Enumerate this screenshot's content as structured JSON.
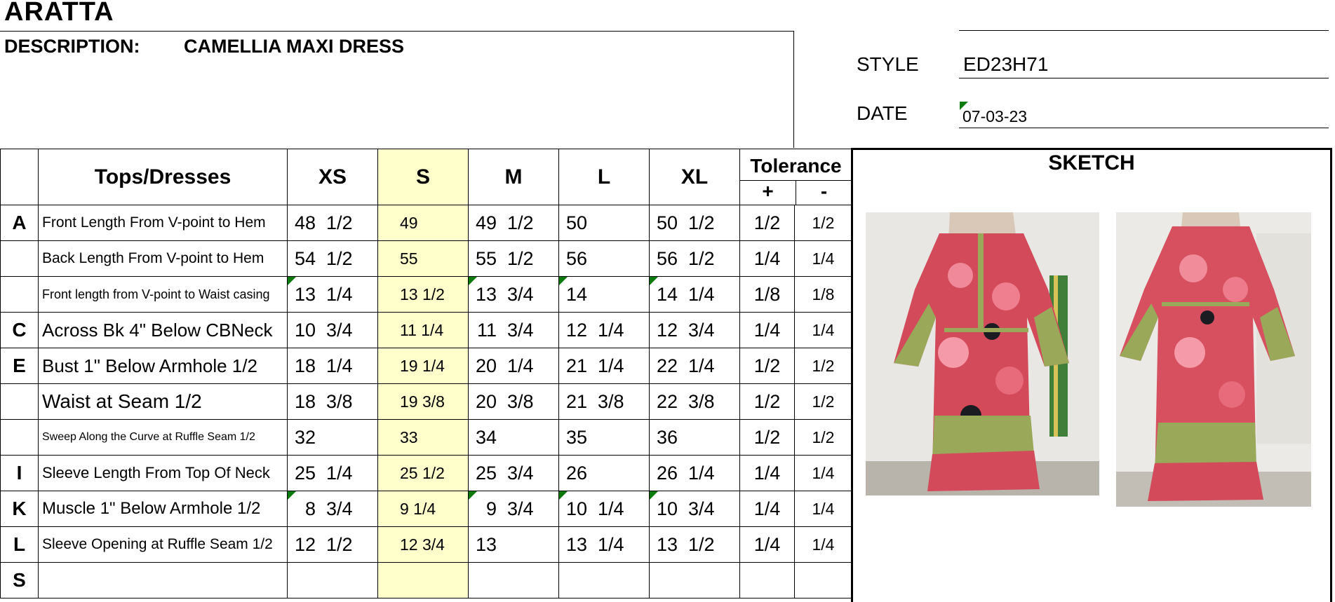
{
  "brand": "ARATTA",
  "description": {
    "label": "DESCRIPTION:",
    "value": "CAMELLIA MAXI DRESS"
  },
  "style": {
    "label": "STYLE",
    "value": "ED23H71"
  },
  "date": {
    "label": "DATE",
    "value": "07-03-23"
  },
  "sketch": {
    "title": "SKETCH",
    "photo_front": "dress-front-photo",
    "photo_back": "dress-back-photo"
  },
  "colors": {
    "s_column": "#ffffcc",
    "marker": "#0a7a0a"
  },
  "table": {
    "header": {
      "category": "Tops/Dresses",
      "sizes": [
        "XS",
        "S",
        "M",
        "L",
        "XL"
      ],
      "tolerance": "Tolerance",
      "plus": "+",
      "minus": "-"
    },
    "rows": [
      {
        "letter": "A",
        "label": "Front Length From V-point to Hem",
        "xs": [
          "48",
          "1/2"
        ],
        "s": "49",
        "m": [
          "49",
          "1/2"
        ],
        "l": [
          "50",
          ""
        ],
        "xl": [
          "50",
          "1/2"
        ],
        "tol_plus": "1/2",
        "tol_minus": "1/2"
      },
      {
        "letter": "",
        "label": "Back Length From V-point to Hem",
        "xs": [
          "54",
          "1/2"
        ],
        "s": "55",
        "m": [
          "55",
          "1/2"
        ],
        "l": [
          "56",
          ""
        ],
        "xl": [
          "56",
          "1/2"
        ],
        "tol_plus": "1/4",
        "tol_minus": "1/4"
      },
      {
        "letter": "",
        "label": "Front length from V-point to Waist casing",
        "xs": [
          "13",
          "1/4"
        ],
        "s": "13 1/2",
        "m": [
          "13",
          "3/4"
        ],
        "l": [
          "14",
          ""
        ],
        "xl": [
          "14",
          "1/4"
        ],
        "tol_plus": "1/8",
        "tol_minus": "1/8"
      },
      {
        "letter": "C",
        "label": "Across Bk 4\" Below CBNeck",
        "xs": [
          "10",
          "3/4"
        ],
        "s": "11 1/4",
        "m": [
          "11",
          "3/4"
        ],
        "l": [
          "12",
          "1/4"
        ],
        "xl": [
          "12",
          "3/4"
        ],
        "tol_plus": "1/4",
        "tol_minus": "1/4"
      },
      {
        "letter": "E",
        "label": " Bust 1\" Below Armhole 1/2",
        "xs": [
          "18",
          "1/4"
        ],
        "s": "19 1/4",
        "m": [
          "20",
          "1/4"
        ],
        "l": [
          "21",
          "1/4"
        ],
        "xl": [
          "22",
          "1/4"
        ],
        "tol_plus": "1/2",
        "tol_minus": "1/2"
      },
      {
        "letter": "",
        "label": "Waist  at Seam 1/2",
        "xs": [
          "18",
          "3/8"
        ],
        "s": "19 3/8",
        "m": [
          "20",
          "3/8"
        ],
        "l": [
          "21",
          "3/8"
        ],
        "xl": [
          "22",
          "3/8"
        ],
        "tol_plus": "1/2",
        "tol_minus": "1/2"
      },
      {
        "letter": "",
        "label": "Sweep  Along the Curve at Ruffle Seam  1/2",
        "xs": [
          "32",
          ""
        ],
        "s": "33",
        "m": [
          "34",
          ""
        ],
        "l": [
          "35",
          ""
        ],
        "xl": [
          "36",
          ""
        ],
        "tol_plus": "1/2",
        "tol_minus": "1/2"
      },
      {
        "letter": "I",
        "label": "Sleeve Length From Top Of  Neck",
        "xs": [
          "25",
          "1/4"
        ],
        "s": "25 1/2",
        "m": [
          "25",
          "3/4"
        ],
        "l": [
          "26",
          ""
        ],
        "xl": [
          "26",
          "1/4"
        ],
        "tol_plus": "1/4",
        "tol_minus": "1/4"
      },
      {
        "letter": "K",
        "label": "Muscle 1\" Below Armhole 1/2",
        "xs": [
          "8",
          "3/4"
        ],
        "s": "9 1/4",
        "m": [
          "9",
          "3/4"
        ],
        "l": [
          "10",
          "1/4"
        ],
        "xl": [
          "10",
          "3/4"
        ],
        "tol_plus": "1/4",
        "tol_minus": "1/4"
      },
      {
        "letter": "L",
        "label": "Sleeve Opening at Ruffle Seam  1/2",
        "xs": [
          "12",
          "1/2"
        ],
        "s": "12 3/4",
        "m": [
          "13",
          ""
        ],
        "l": [
          "13",
          "1/4"
        ],
        "xl": [
          "13",
          "1/2"
        ],
        "tol_plus": "1/4",
        "tol_minus": "1/4"
      },
      {
        "letter": "S",
        "label": "",
        "xs": [
          "",
          ""
        ],
        "s": "",
        "m": [
          "",
          ""
        ],
        "l": [
          "",
          ""
        ],
        "xl": [
          "",
          ""
        ],
        "tol_plus": "",
        "tol_minus": ""
      }
    ]
  }
}
